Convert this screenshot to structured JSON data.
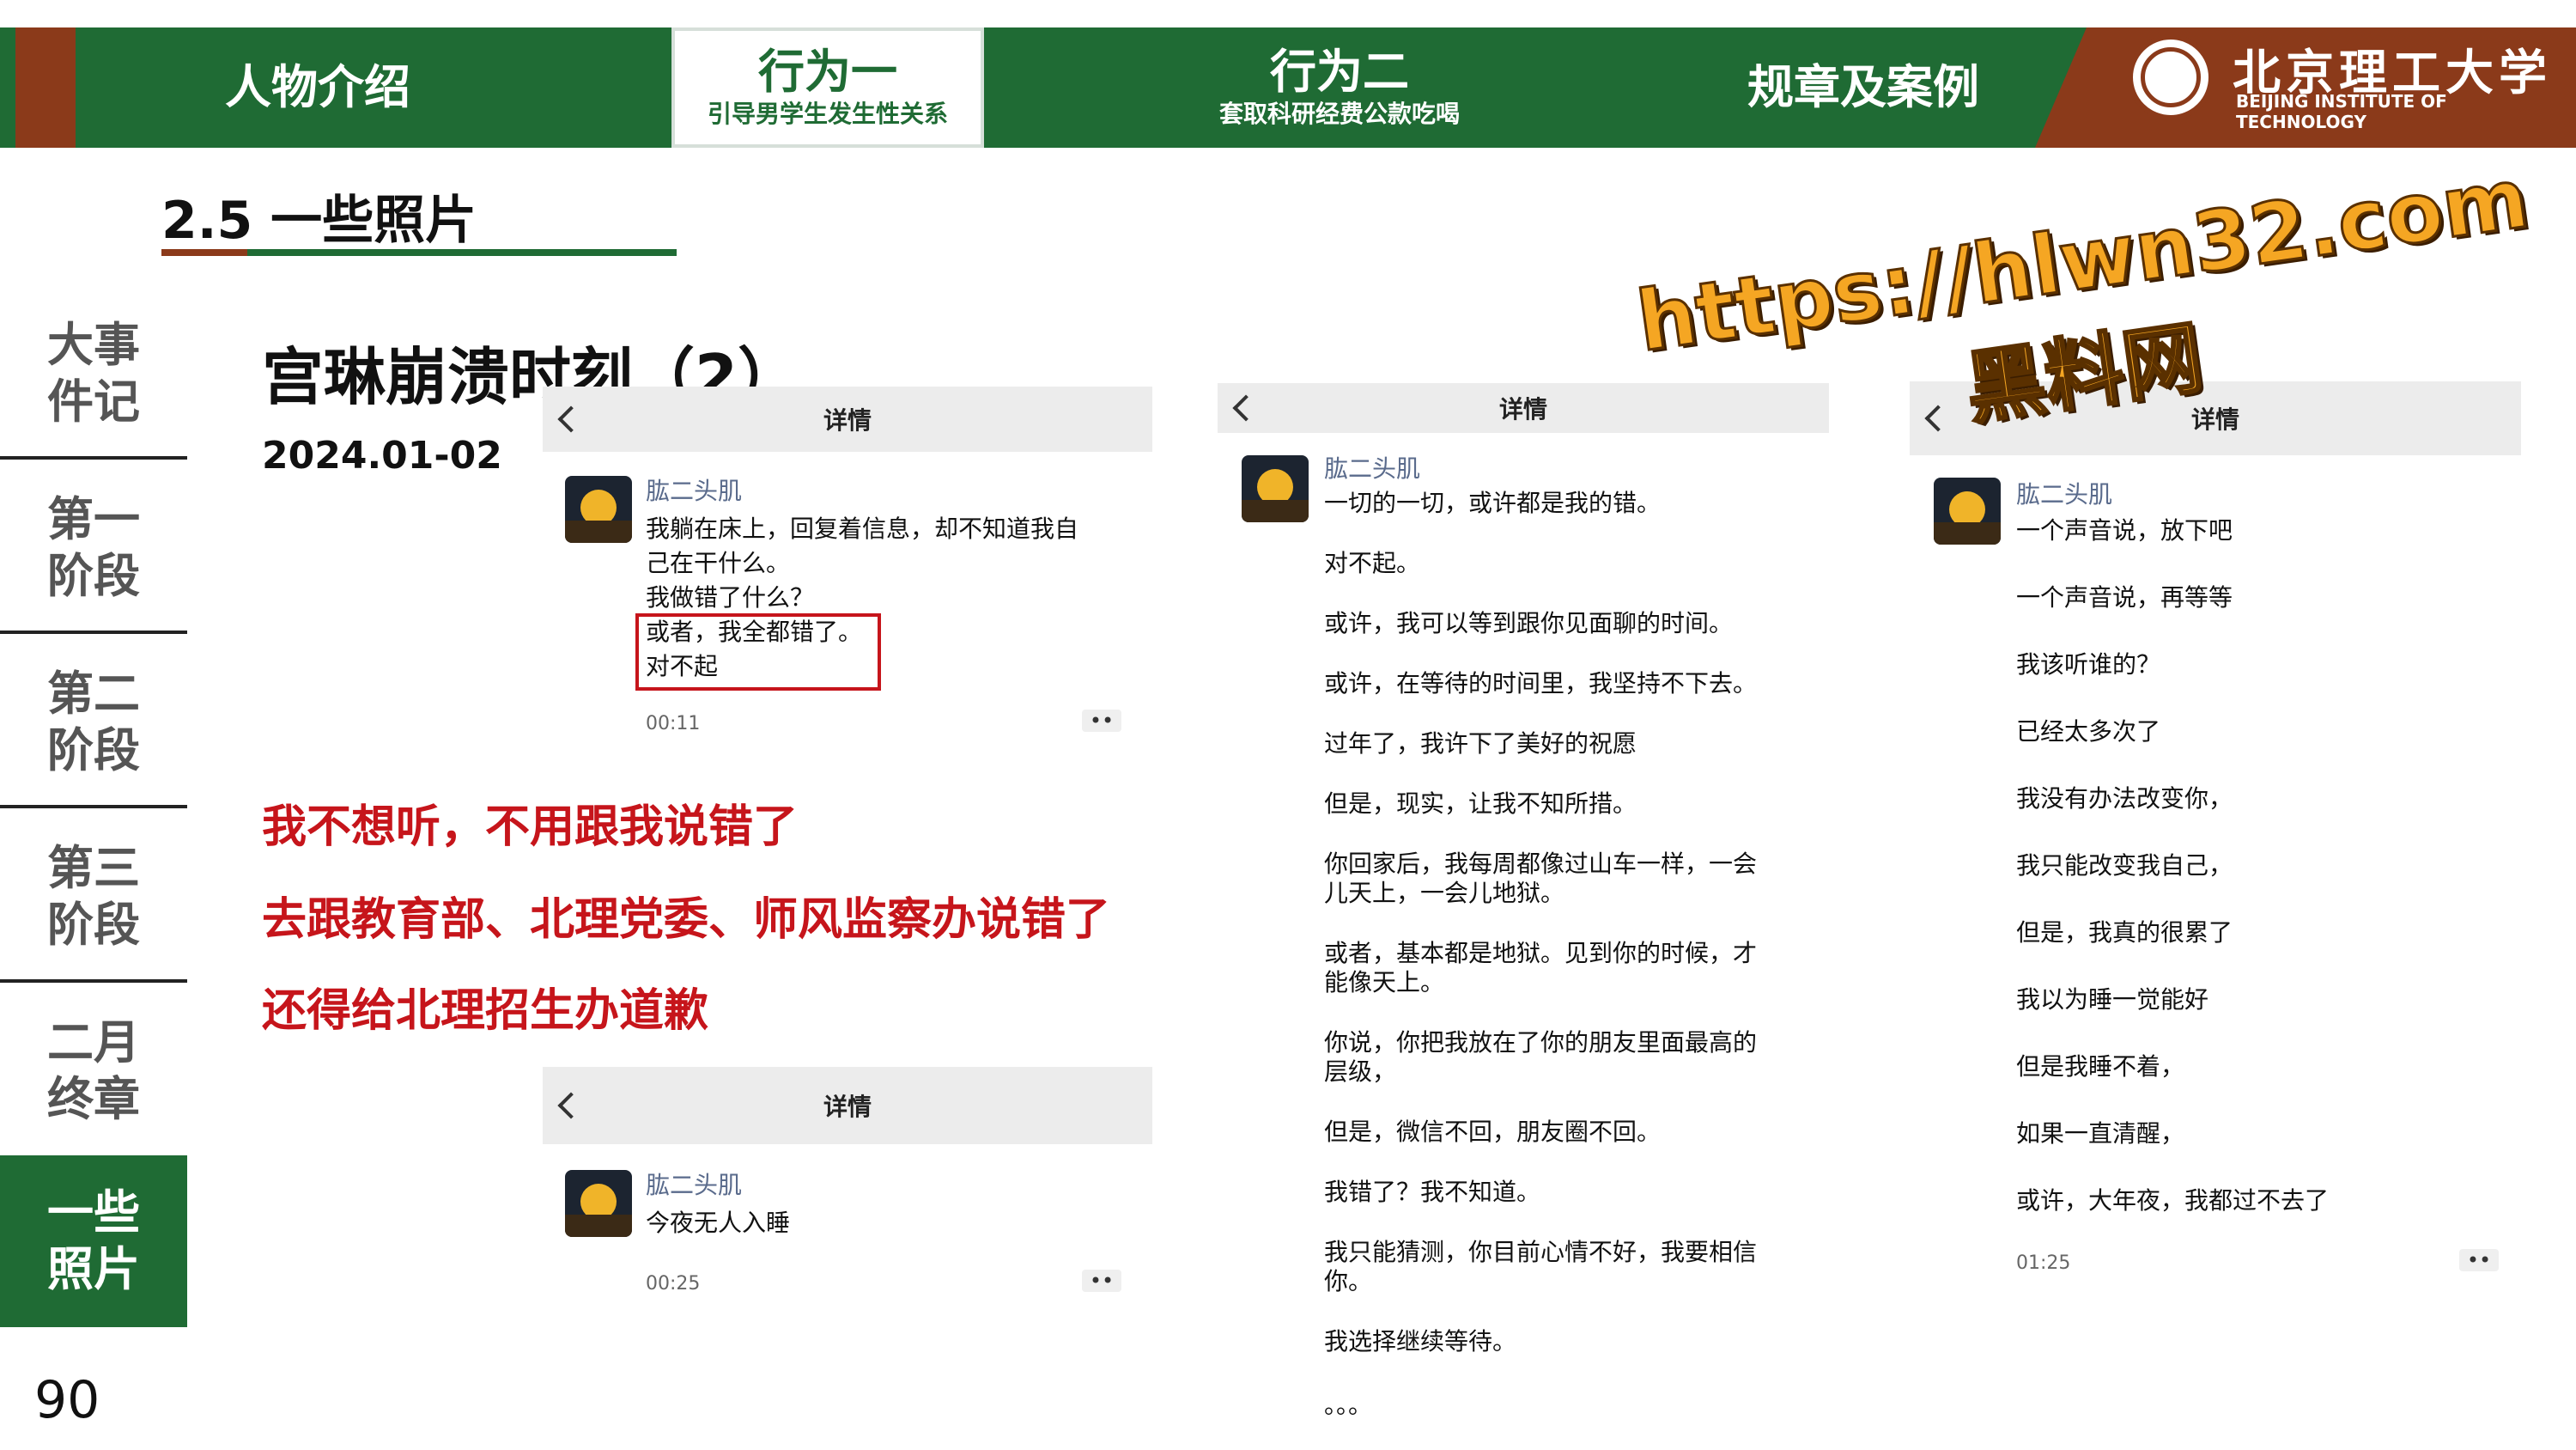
{
  "nav": {
    "tabs": [
      {
        "label": "人物介绍",
        "sub": ""
      },
      {
        "label": "行为一",
        "sub": "引导男学生发生性关系"
      },
      {
        "label": "行为二",
        "sub": "套取科研经费公款吃喝"
      },
      {
        "label": "规章及案例",
        "sub": ""
      }
    ],
    "logo_cn": "北京理工大学",
    "logo_en": "BEIJING INSTITUTE OF TECHNOLOGY"
  },
  "section_title": "2.5 一些照片",
  "sidebar": {
    "items": [
      {
        "label": "大事件记"
      },
      {
        "label": "第一阶段"
      },
      {
        "label": "第二阶段"
      },
      {
        "label": "第三阶段"
      },
      {
        "label": "二月终章"
      },
      {
        "label": "一些照片"
      }
    ],
    "active_index": 5,
    "page_number": "90"
  },
  "main": {
    "heading": "宫琳崩溃时刻（2）",
    "date": "2024.01-02",
    "red_lines": [
      "我不想听，不用跟我说错了",
      "去跟教育部、北理党委、师风监察办说错了",
      "还得给北理招生办道歉"
    ]
  },
  "watermark": {
    "url": "https://hlwn32.com",
    "name": "黑料网"
  },
  "cards": {
    "card1": {
      "header": "详情",
      "name": "肱二头肌",
      "lines": [
        "我躺在床上，回复着信息，却不知道我自",
        "己在干什么。",
        "我做错了什么？",
        "或者，我全都错了。",
        "对不起"
      ],
      "time": "00:11",
      "more": "••"
    },
    "card2": {
      "header": "详情",
      "name": "肱二头肌",
      "lines": [
        "今夜无人入睡"
      ],
      "time": "00:25",
      "more": "••"
    },
    "card3": {
      "header": "详情",
      "name": "肱二头肌",
      "lines": [
        "一切的一切，或许都是我的错。",
        "对不起。",
        "或许，我可以等到跟你见面聊的时间。",
        "或许，在等待的时间里，我坚持不下去。",
        "过年了，我许下了美好的祝愿",
        "但是，现实，让我不知所措。",
        "你回家后，我每周都像过山车一样，一会",
        "儿天上，一会儿地狱。",
        "或者，基本都是地狱。见到你的时候，才",
        "能像天上。",
        "你说，你把我放在了你的朋友里面最高的",
        "层级，",
        "但是，微信不回，朋友圈不回。",
        "我错了？我不知道。",
        "我只能猜测，你目前心情不好，我要相信",
        "你。",
        "我选择继续等待。",
        "。。。"
      ]
    },
    "card4": {
      "header": "详情",
      "name": "肱二头肌",
      "lines": [
        "一个声音说，放下吧",
        "一个声音说，再等等",
        "我该听谁的？",
        "已经太多次了",
        "我没有办法改变你，",
        "我只能改变我自己，",
        "但是，我真的很累了",
        "我以为睡一觉能好",
        "但是我睡不着，",
        "如果一直清醒，",
        "或许，大年夜，我都过不去了"
      ],
      "time": "01:25",
      "more": "••"
    }
  }
}
